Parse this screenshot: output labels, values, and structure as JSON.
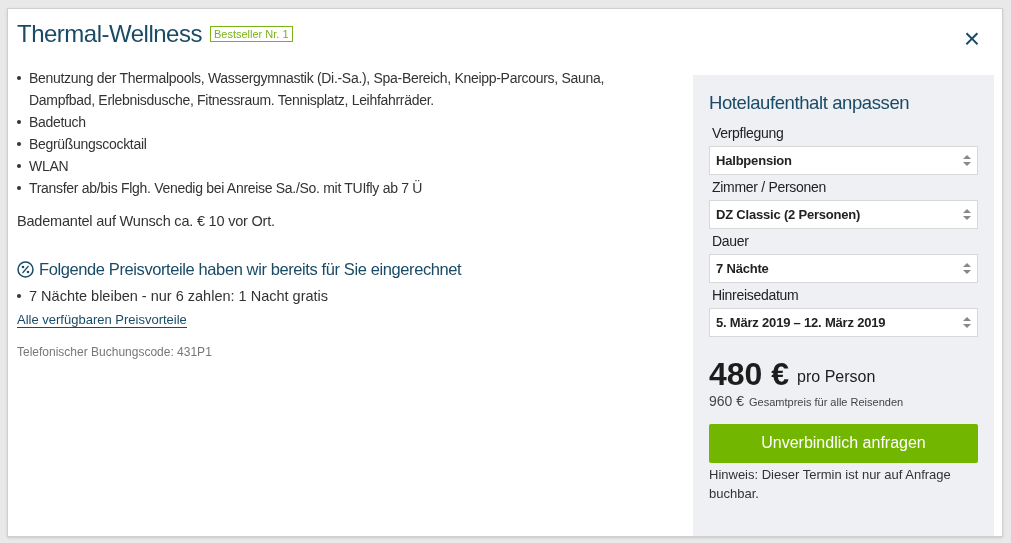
{
  "title": "Thermal-Wellness",
  "badge": "Bestseller Nr. 1",
  "close": "×",
  "features": [
    "Benutzung der Thermalpools, Wassergymnastik (Di.-Sa.), Spa-Bereich, Kneipp-Parcours, Sauna, Dampfbad, Erlebnisdusche, Fitnessraum. Tennisplatz, Leihfahrräder.",
    "Badetuch",
    "Begrüßungscocktail",
    "WLAN",
    "Transfer ab/bis Flgh. Venedig bei Anreise Sa./So. mit TUIfly ab 7 Ü"
  ],
  "note": "Bademantel auf Wunsch ca. € 10 vor Ort.",
  "advantages": {
    "heading": "Folgende Preisvorteile haben wir bereits für Sie eingerechnet",
    "items": [
      "7 Nächte bleiben - nur 6 zahlen: 1 Nacht gratis"
    ],
    "link": "Alle verfügbaren Preisvorteile"
  },
  "booking_code": "Telefonischer Buchungscode: 431P1",
  "panel": {
    "title": "Hotelaufenthalt anpassen",
    "fields": [
      {
        "label": "Verpflegung",
        "value": "Halbpension"
      },
      {
        "label": "Zimmer / Personen",
        "value": "DZ Classic (2 Personen)"
      },
      {
        "label": "Dauer",
        "value": "7 Nächte"
      },
      {
        "label": "Hinreisedatum",
        "value": "5. März 2019 – 12. März 2019"
      }
    ],
    "price": "480 €",
    "price_unit": "pro Person",
    "total": "960 €",
    "total_label": "Gesamtpreis für alle Reisenden",
    "button": "Unverbindlich anfragen",
    "hint": "Hinweis: Dieser Termin ist nur auf Anfrage buchbar."
  }
}
